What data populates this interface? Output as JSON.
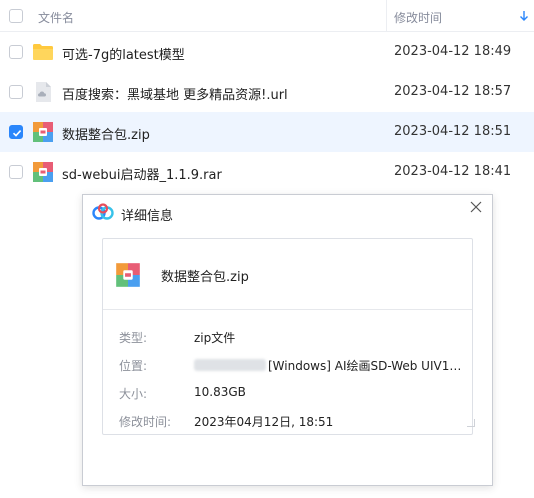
{
  "header": {
    "name_label": "文件名",
    "time_label": "修改时间"
  },
  "files": [
    {
      "name": "可选-7g的latest模型",
      "time": "2023-04-12 18:49",
      "icon": "folder-icon",
      "selected": false
    },
    {
      "name": "百度搜索：黑域基地 更多精品资源!.url",
      "time": "2023-04-12 18:57",
      "icon": "url-file-icon",
      "selected": false
    },
    {
      "name": "数据整合包.zip",
      "time": "2023-04-12 18:51",
      "icon": "zip-archive-icon",
      "selected": true
    },
    {
      "name": "sd-webui启动器_1.1.9.rar",
      "time": "2023-04-12 18:41",
      "icon": "rar-archive-icon",
      "selected": false
    }
  ],
  "dialog": {
    "title": "详细信息",
    "file_name": "数据整合包.zip",
    "type_label": "类型:",
    "type_value": "zip文件",
    "location_label": "位置:",
    "location_value": "[Windows] AI绘画SD-Web UIV1....",
    "size_label": "大小:",
    "size_value": "10.83GB",
    "modified_label": "修改时间:",
    "modified_value": "2023年04月12日, 18:51"
  },
  "colors": {
    "accent": "#2a86fb",
    "selected_row": "#eef5ff",
    "folder": "#ffc93e"
  }
}
